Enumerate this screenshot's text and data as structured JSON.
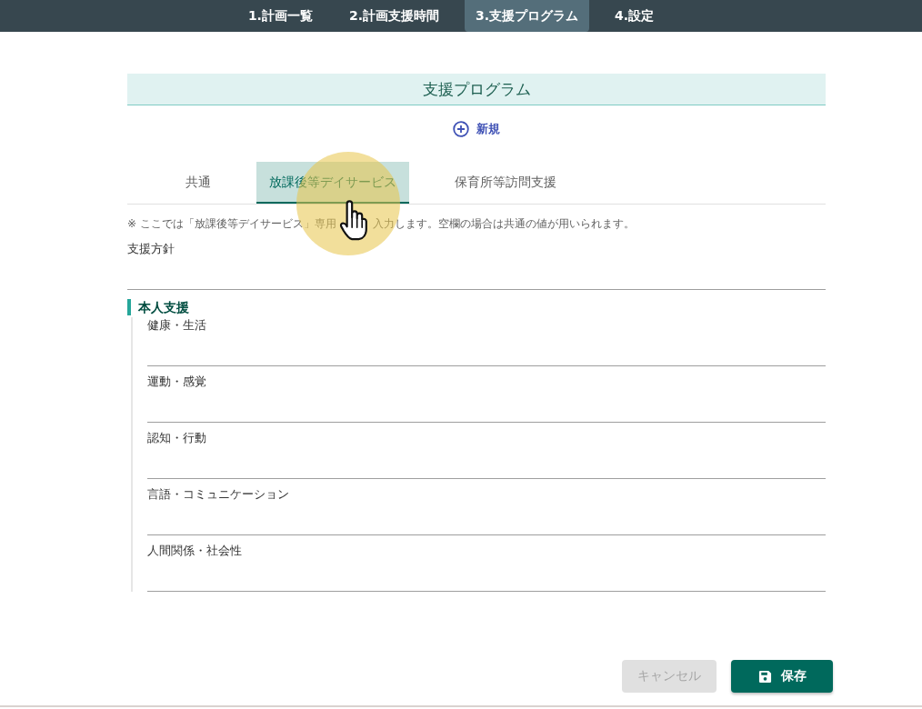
{
  "nav": {
    "items": [
      {
        "label": "1.計画一覧",
        "selected": false
      },
      {
        "label": "2.計画支援時間",
        "selected": false
      },
      {
        "label": "3.支援プログラム",
        "selected": true
      },
      {
        "label": "4.設定",
        "selected": false
      }
    ]
  },
  "panel": {
    "title": "支援プログラム",
    "new_button": {
      "label": "新規"
    },
    "tabs": [
      {
        "label": "共通",
        "selected": false
      },
      {
        "label": "放課後等デイサービス",
        "selected": true
      },
      {
        "label": "保育所等訪問支援",
        "selected": false
      }
    ],
    "note_fragments": [
      "※ ここでは「放課後等デイサービス」専用",
      "入力します。空欄の場合は共通の値が用いられます。"
    ],
    "policy_field": {
      "label": "支援方針"
    },
    "section": {
      "title": "本人支援",
      "fields": [
        {
          "label": "健康・生活"
        },
        {
          "label": "運動・感覚"
        },
        {
          "label": "認知・行動"
        },
        {
          "label": "言語・コミュニケーション"
        },
        {
          "label": "人間関係・社会性"
        }
      ]
    }
  },
  "actions": [
    {
      "kind": "cancel",
      "label": "キャンセル",
      "disabled": true
    },
    {
      "kind": "save",
      "label": "保存",
      "disabled": false
    }
  ]
}
